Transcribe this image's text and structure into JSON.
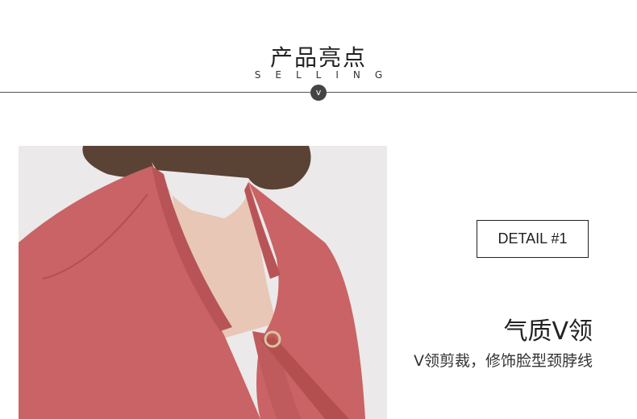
{
  "header": {
    "title": "产品亮点",
    "subtitle": "SELLING",
    "badge": "v"
  },
  "detail": {
    "label": "DETAIL #1",
    "title": "气质V领",
    "description": "V领剪裁，修饰脸型颈脖线"
  },
  "photo": {
    "description_icon": "model-photo",
    "blouse_color": "#c96365",
    "hair_color": "#5a4334",
    "skin_color": "#e8c7b6"
  }
}
